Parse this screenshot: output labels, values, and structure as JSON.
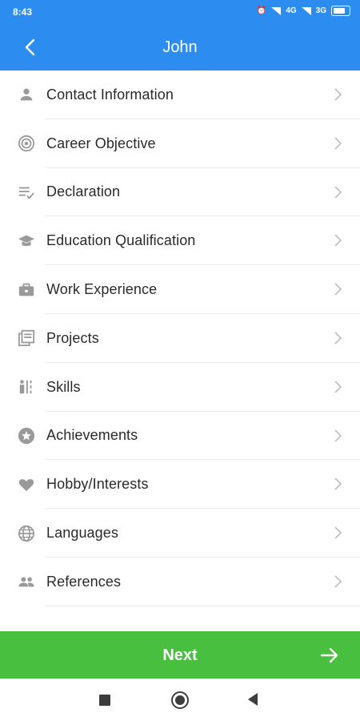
{
  "status_bar": {
    "time": "8:43",
    "network_left": "4G",
    "network_right": "3G",
    "battery": "70"
  },
  "app_bar": {
    "title": "John"
  },
  "menu": [
    {
      "label": "Contact Information",
      "icon": "person-icon"
    },
    {
      "label": "Career Objective",
      "icon": "target-icon"
    },
    {
      "label": "Declaration",
      "icon": "list-check-icon"
    },
    {
      "label": "Education Qualification",
      "icon": "graduation-cap-icon"
    },
    {
      "label": "Work Experience",
      "icon": "briefcase-icon"
    },
    {
      "label": "Projects",
      "icon": "projects-icon"
    },
    {
      "label": "Skills",
      "icon": "skills-icon"
    },
    {
      "label": "Achievements",
      "icon": "star-badge-icon"
    },
    {
      "label": "Hobby/Interests",
      "icon": "heart-icon"
    },
    {
      "label": "Languages",
      "icon": "globe-icon"
    },
    {
      "label": "References",
      "icon": "people-icon"
    }
  ],
  "next_button": {
    "label": "Next"
  },
  "colors": {
    "primary": "#2d8cf0",
    "next": "#49bf3f",
    "icon": "#9a9a9a"
  }
}
